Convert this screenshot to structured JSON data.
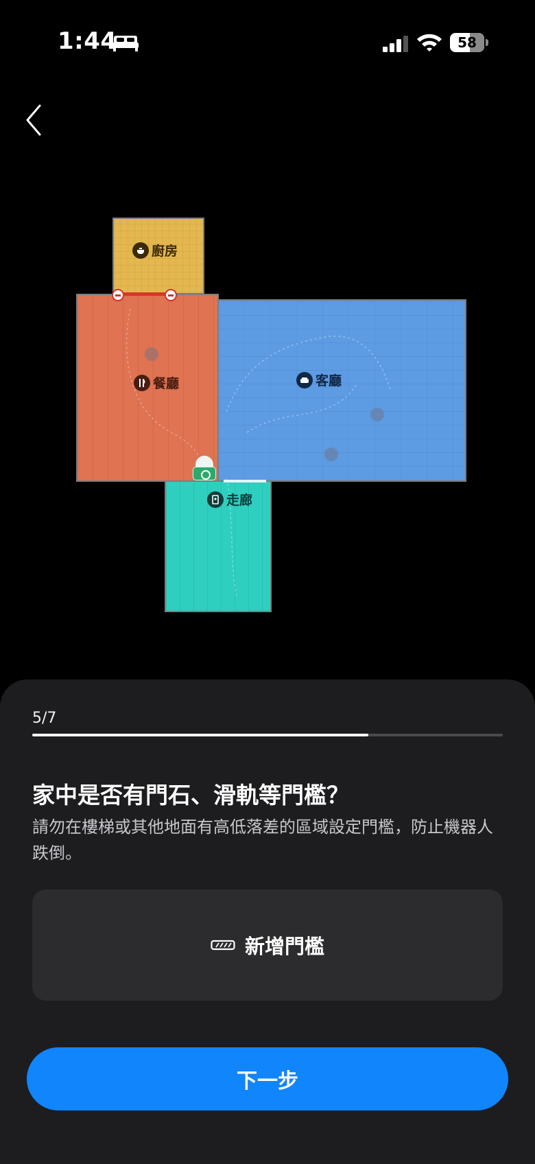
{
  "status_bar": {
    "time": "1:44",
    "battery": "58",
    "battery_level": 0.58,
    "icons": [
      "bed-icon",
      "signal-icon",
      "wifi-icon",
      "battery-icon"
    ]
  },
  "nav": {
    "back_icon": "chevron-left-icon"
  },
  "map": {
    "rooms": [
      {
        "name": "廚房",
        "icon": "cooking-pot-icon",
        "color": "#e4b74f"
      },
      {
        "name": "餐廳",
        "icon": "fork-knife-icon",
        "color": "#df7352"
      },
      {
        "name": "客廳",
        "icon": "sofa-icon",
        "color": "#5d9be3"
      },
      {
        "name": "走廊",
        "icon": "door-icon",
        "color": "#2fcfbf"
      }
    ]
  },
  "sheet": {
    "step": "5/7",
    "progress": 0.714,
    "title": "家中是否有門石、滑軌等門檻？",
    "description": "請勿在樓梯或其他地面有高低落差的區域設定門檻，防止機器人跌倒。",
    "add_button": {
      "label": "新增門檻",
      "icon": "threshold-icon"
    },
    "next_button": "下一步"
  },
  "colors": {
    "accent": "#1185fb",
    "sheet_bg": "#1d1d1f",
    "card_bg": "#2c2c2e"
  }
}
